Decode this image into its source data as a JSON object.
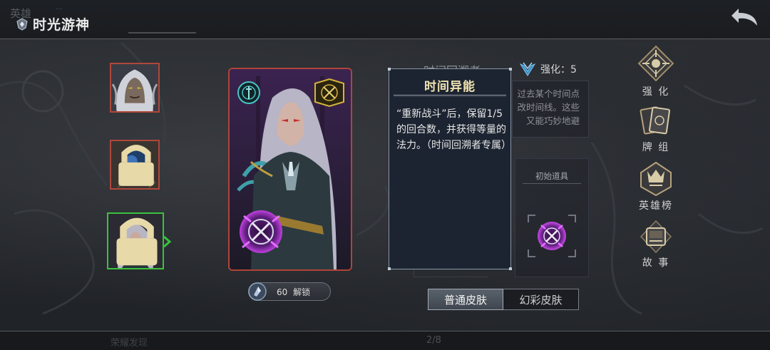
{
  "header": {
    "ghost_title": "英雄",
    "ghost_sub": "···",
    "title": "时光游神",
    "back_icon": "back-arrow-icon"
  },
  "heroes": [
    {
      "name": "hero-white-hair",
      "locked": false,
      "selected": false
    },
    {
      "name": "hero-blue-rose",
      "locked": true,
      "selected": false
    },
    {
      "name": "hero-time-traveler",
      "locked": true,
      "selected": true
    }
  ],
  "card": {
    "skill_icons": [
      "dagger-rune-icon",
      "crossed-swords-icon",
      "time-dagger-icon"
    ]
  },
  "unlock": {
    "cost": "60",
    "label": "解锁"
  },
  "info": {
    "ghost_name": "时间回溯者",
    "strength_label": "强化：5",
    "desc_lines": [
      "过去某个时间点",
      "改时间线。这些",
      "又能巧妙地避"
    ],
    "items_label": "初始道具"
  },
  "tooltip": {
    "title": "时间异能",
    "body": "“重新战斗”后，保留1/5的回合数，并获得等量的法力。（时间回溯者专属）"
  },
  "skins": {
    "normal": "普通皮肤",
    "fancy": "幻彩皮肤",
    "active": "normal"
  },
  "menu": [
    {
      "label": "强 化",
      "icon": "enhance-icon"
    },
    {
      "label": "牌 组",
      "icon": "card-deck-icon"
    },
    {
      "label": "英雄榜",
      "icon": "hero-ranking-icon"
    },
    {
      "label": "故 事",
      "icon": "story-icon"
    }
  ],
  "footer": {
    "ghost_left": "荣耀发现",
    "ghost_page": "2/8"
  },
  "colors": {
    "accent_gold": "#f0e2b0",
    "selected_green": "#3ac23d",
    "card_red": "#b04438"
  }
}
